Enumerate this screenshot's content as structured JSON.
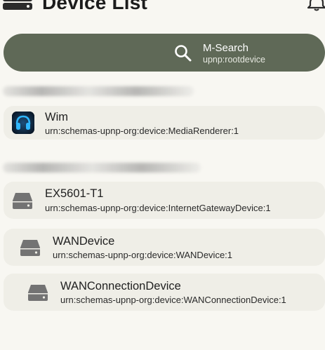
{
  "header": {
    "title": "Device List"
  },
  "search": {
    "title": "M-Search",
    "subtitle": "upnp:rootdevice"
  },
  "groups": [
    {
      "devices": [
        {
          "name": "Wim",
          "type": "urn:schemas-upnp-org:device:MediaRenderer:1",
          "icon": "media-renderer-app-icon"
        }
      ]
    },
    {
      "devices": [
        {
          "name": "EX5601-T1",
          "type": "urn:schemas-upnp-org:device:InternetGatewayDevice:1",
          "icon": "hard-drive-icon"
        },
        {
          "name": "WANDevice",
          "type": "urn:schemas-upnp-org:device:WANDevice:1",
          "icon": "hard-drive-icon"
        },
        {
          "name": "WANConnectionDevice",
          "type": "urn:schemas-upnp-org:device:WANConnectionDevice:1",
          "icon": "hard-drive-icon"
        }
      ]
    }
  ],
  "colors": {
    "search_bar": "#5f6957",
    "card": "#efeee7",
    "background": "#f8f7f2",
    "drive_icon": "#737373"
  }
}
